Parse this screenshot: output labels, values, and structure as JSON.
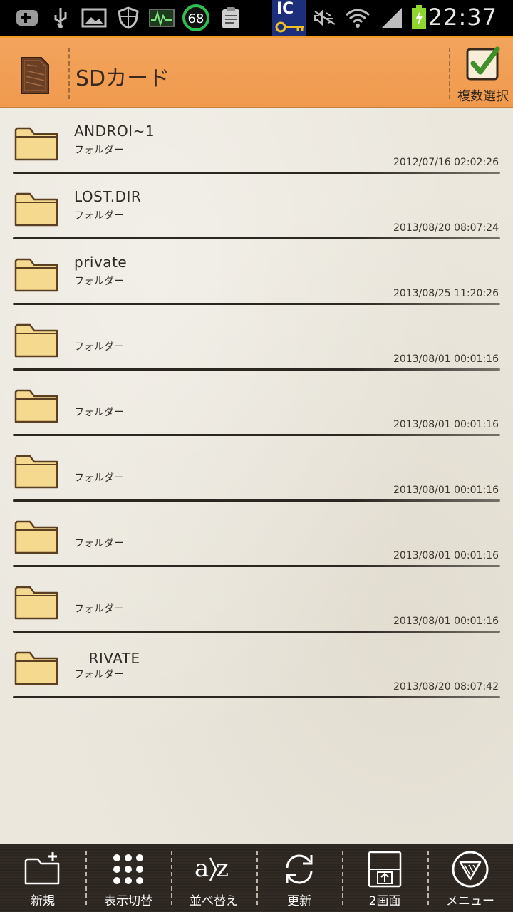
{
  "status_bar": {
    "time": "22:37",
    "badge_number": "68",
    "ic_label": "IC",
    "icons": [
      "add-notification-icon",
      "usb-icon",
      "image-icon",
      "shield-icon",
      "activity-monitor-icon",
      "counter-badge-icon",
      "clipboard-icon",
      "ic-key-icon",
      "mute-icon",
      "wifi-icon",
      "signal-icon",
      "battery-charging-icon"
    ]
  },
  "header": {
    "title": "SDカード",
    "multi_select_label": "複数選択"
  },
  "files": [
    {
      "name": "ANDROI~1",
      "kind": "フォルダー",
      "date": "2012/07/16 02:02:26"
    },
    {
      "name": "LOST.DIR",
      "kind": "フォルダー",
      "date": "2013/08/20 08:07:24"
    },
    {
      "name": "private",
      "kind": "フォルダー",
      "date": "2013/08/25 11:20:26"
    },
    {
      "name": "",
      "kind": "フォルダー",
      "date": "2013/08/01 00:01:16"
    },
    {
      "name": "",
      "kind": "フォルダー",
      "date": "2013/08/01 00:01:16"
    },
    {
      "name": "",
      "kind": "フォルダー",
      "date": "2013/08/01 00:01:16"
    },
    {
      "name": "",
      "kind": "フォルダー",
      "date": "2013/08/01 00:01:16"
    },
    {
      "name": "",
      "kind": "フォルダー",
      "date": "2013/08/01 00:01:16"
    },
    {
      "name": "　RIVATE",
      "kind": "フォルダー",
      "date": "2013/08/20 08:07:42"
    }
  ],
  "toolbar": {
    "new_label": "新規",
    "view_label": "表示切替",
    "sort_label": "並べ替え",
    "refresh_label": "更新",
    "dual_label": "2画面",
    "menu_label": "メニュー"
  },
  "colors": {
    "header_orange": "#f09a4e",
    "folder_yellow": "#f4d98e",
    "bottom_bar": "#2e2721"
  }
}
